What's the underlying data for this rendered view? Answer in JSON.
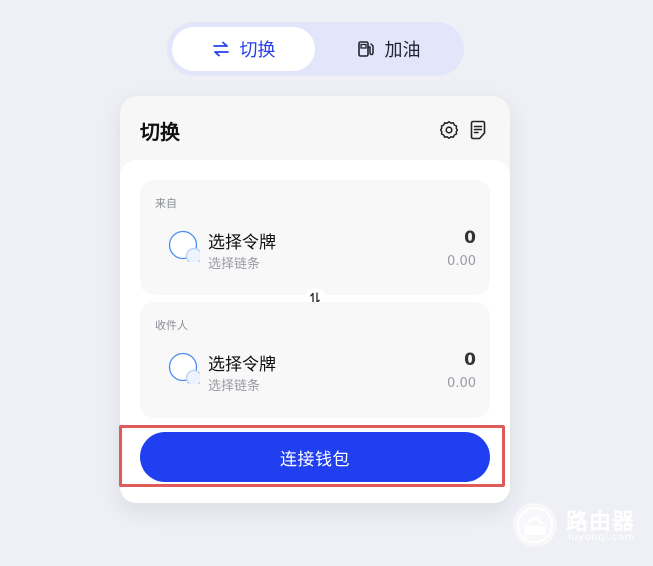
{
  "tabs": [
    {
      "label": "切换",
      "icon": "swap-arrows-icon",
      "active": true
    },
    {
      "label": "加油",
      "icon": "fuel-pump-icon",
      "active": false
    }
  ],
  "card": {
    "title": "切换",
    "settings_icon": "gear-icon",
    "history_icon": "document-list-icon"
  },
  "from": {
    "label": "来自",
    "token": "选择令牌",
    "chain": "选择链条",
    "amount": "0",
    "value": "0.00"
  },
  "to": {
    "label": "收件人",
    "token": "选择令牌",
    "chain": "选择链条",
    "amount": "0",
    "value": "0.00"
  },
  "connect_button": "连接钱包",
  "watermark": {
    "name": "路由器",
    "url": "luyouqi.com"
  },
  "colors": {
    "accent": "#1f3ff0",
    "tab_active_text": "#2740e8",
    "highlight_border": "#e05a5a",
    "page_bg": "#eff0f6"
  }
}
